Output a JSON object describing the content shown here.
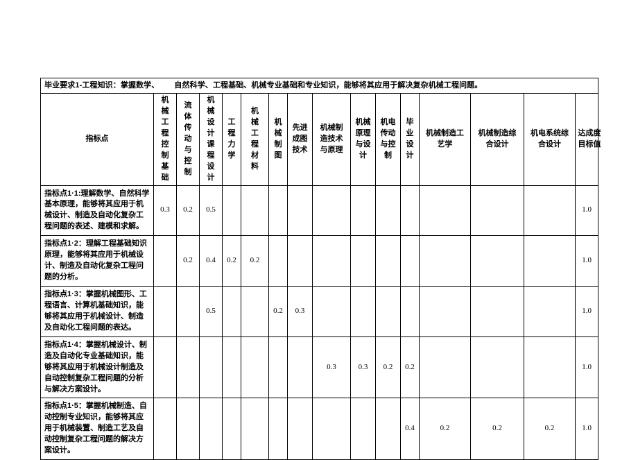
{
  "document": {
    "title_prefix": "毕业要求1-工程知识：掌握数学、",
    "title_suffix": "自然科学、工程基础、机械专业基础和专业知识，能够将其应用于解决复杂机械工程问题。"
  },
  "table": {
    "row_header_label": "指标点",
    "columns": [
      {
        "id": "col-mech-eng-control",
        "label": "机械工程控制基础",
        "style": "vnarrow"
      },
      {
        "id": "col-fluid-drive-control",
        "label": "流体传动与控制",
        "style": "vnarrow"
      },
      {
        "id": "col-mech-design-course",
        "label": "机械设计课程设计",
        "style": "vnarrow"
      },
      {
        "id": "col-eng-mechanics",
        "label": "工程力学",
        "style": "vnarrow"
      },
      {
        "id": "col-mech-eng-materials",
        "label": "机械工程材料",
        "style": "vnarrow"
      },
      {
        "id": "col-mech-drafting",
        "label": "机械制图",
        "style": "vnarrow"
      },
      {
        "id": "col-advanced-drafting-tech",
        "label": "先进成图技术",
        "style": "vnarrow2"
      },
      {
        "id": "col-mfg-tech-principles",
        "label": "机械制造技术与原理",
        "style": "vnarrow3"
      },
      {
        "id": "col-mech-principles-design",
        "label": "机械原理与设计",
        "style": "vnarrow2"
      },
      {
        "id": "col-electromech-drive-control",
        "label": "机电传动与控制",
        "style": "vnarrow2"
      },
      {
        "id": "col-graduation-design",
        "label": "毕业设计",
        "style": "vnarrow"
      },
      {
        "id": "col-mfg-process",
        "label": "机械制造工艺学",
        "style": "vwide"
      },
      {
        "id": "col-mfg-comprehensive-design",
        "label": "机械制造综合设计",
        "style": "vwide"
      },
      {
        "id": "col-electromech-system-design",
        "label": "机电系统综合设计",
        "style": "vwide"
      },
      {
        "id": "col-achievement-target",
        "label": "达成度目标值",
        "style": "vnarrow3"
      }
    ],
    "rows": [
      {
        "id": "indicator-1-1",
        "label": "指标点1·1:理解数学、自然科学基本原理，能够将其应用于机械设计、制造及自动化复杂工程问题的表述、建模和求解。",
        "values": [
          "0.3",
          "0.2",
          "0.5",
          "",
          "",
          "",
          "",
          "",
          "",
          "",
          "",
          "",
          "",
          "",
          "1.0"
        ]
      },
      {
        "id": "indicator-1-2",
        "label": "指标点1·2：理解工程基础知识原理，能够将其应用于机械设计、制造及自动化复杂工程问题的分析。",
        "values": [
          "",
          "0.2",
          "0.4",
          "0.2",
          "0.2",
          "",
          "",
          "",
          "",
          "",
          "",
          "",
          "",
          "",
          "1.0"
        ]
      },
      {
        "id": "indicator-1-3",
        "label": "指标点1·3：掌握机械图形、工程语言、计算机基础知识，能够将其应用于机械设计、制造及自动化工程问题的表达。",
        "values": [
          "",
          "",
          "0.5",
          "",
          "",
          "0.2",
          "0.3",
          "",
          "",
          "",
          "",
          "",
          "",
          "",
          "1.0"
        ]
      },
      {
        "id": "indicator-1-4",
        "label": "指标点1·4：掌握机械设计、制造及自动化专业基础知识，能够将其应用于机械设计制造及自动控制复杂工程问题的分析与解决方案设计。",
        "values": [
          "",
          "",
          "",
          "",
          "",
          "",
          "",
          "0.3",
          "0.3",
          "0.2",
          "0.2",
          "",
          "",
          "",
          "1.0"
        ]
      },
      {
        "id": "indicator-1-5",
        "label": "指标点1·5：掌握机械制造、自动控制专业知识，能够将其应用于机械装置、制造工艺及自动控制复杂工程问题的解决方案设计。",
        "values": [
          "",
          "",
          "",
          "",
          "",
          "",
          "",
          "",
          "",
          "",
          "0.4",
          "0.2",
          "0.2",
          "0.2",
          "1.0"
        ]
      }
    ]
  }
}
